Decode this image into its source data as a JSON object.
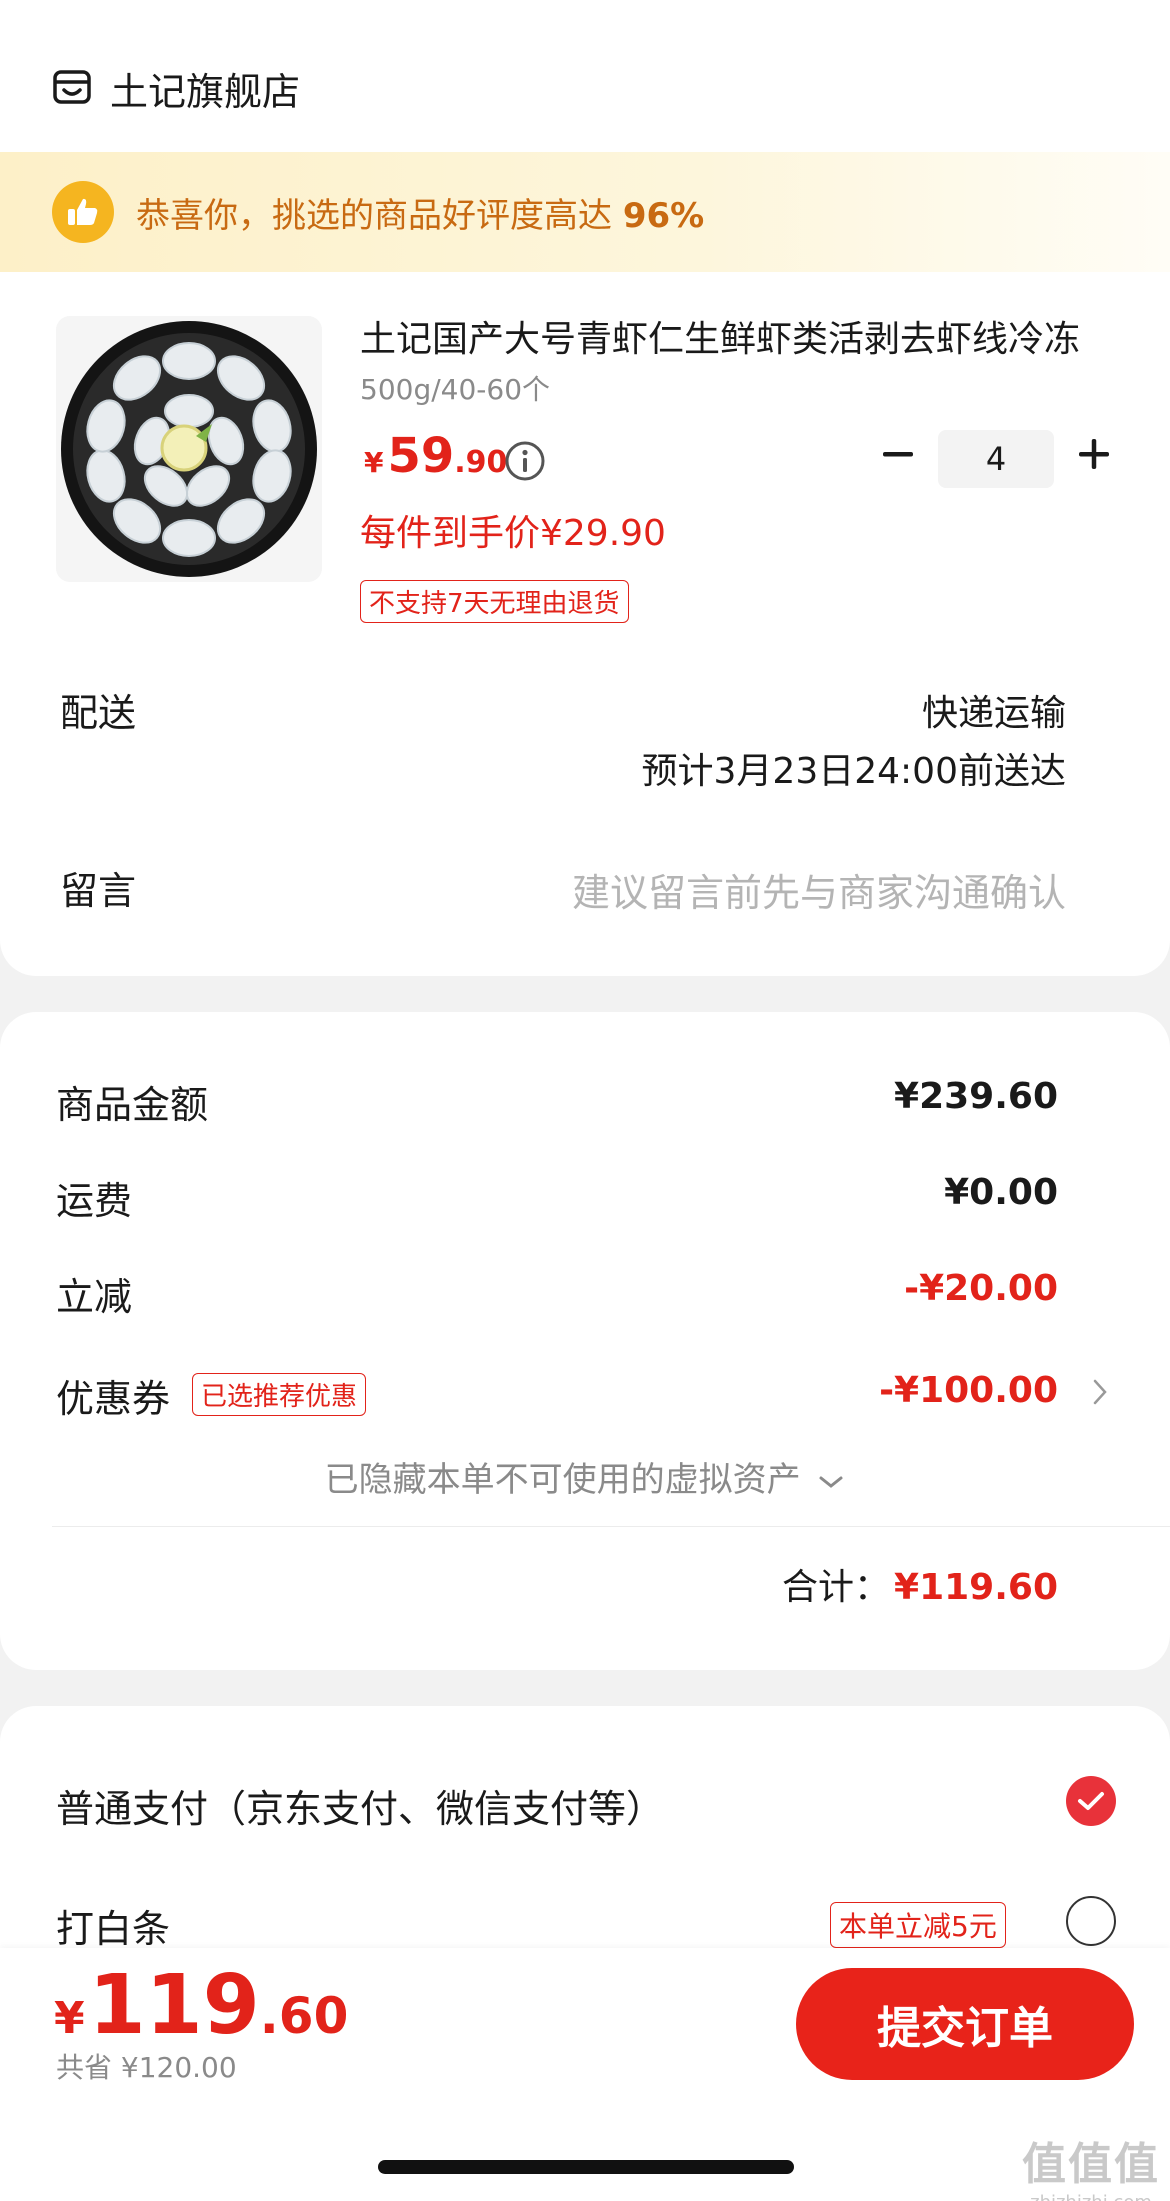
{
  "store": {
    "name": "土记旗舰店",
    "banner_text": "恭喜你，挑选的商品好评度高达",
    "banner_percent": "96%"
  },
  "product": {
    "title": "土记国产大号青虾仁生鲜虾类活剥去虾线冷冻",
    "spec": "500g/40-60个",
    "price_symbol": "¥",
    "price_int": "59",
    "price_dec": ".90",
    "quantity": "4",
    "unit_price_label": "每件到手价¥29.90",
    "return_tag": "不支持7天无理由退货"
  },
  "delivery": {
    "label": "配送",
    "method": "快递运输",
    "eta": "预计3月23日24:00前送达"
  },
  "message": {
    "label": "留言",
    "placeholder": "建议留言前先与商家沟通确认"
  },
  "summary": {
    "goods_label": "商品金额",
    "goods_value": "¥239.60",
    "shipping_label": "运费",
    "shipping_value": "¥0.00",
    "discount_label": "立减",
    "discount_value": "-¥20.00",
    "coupon_label": "优惠券",
    "coupon_tag": "已选推荐优惠",
    "coupon_value": "-¥100.00",
    "hidden_assets": "已隐藏本单不可使用的虚拟资产",
    "total_label": "合计：",
    "total_value": "¥119.60"
  },
  "payment": {
    "normal_label": "普通支付（京东支付、微信支付等）",
    "normal_selected": true,
    "baitiao_label": "打白条",
    "baitiao_promo": "本单立减5元",
    "baitiao_selected": false
  },
  "bottom": {
    "price_symbol": "¥",
    "price_int": "119",
    "price_dec": ".60",
    "saved": "共省 ¥120.00",
    "submit_label": "提交订单"
  },
  "watermark": {
    "chars": "值值值",
    "url": "zhizhizhi.com"
  },
  "colors": {
    "accent_red": "#e2231a",
    "banner_text": "#c86a12",
    "banner_bg": "#fdf0c8"
  }
}
